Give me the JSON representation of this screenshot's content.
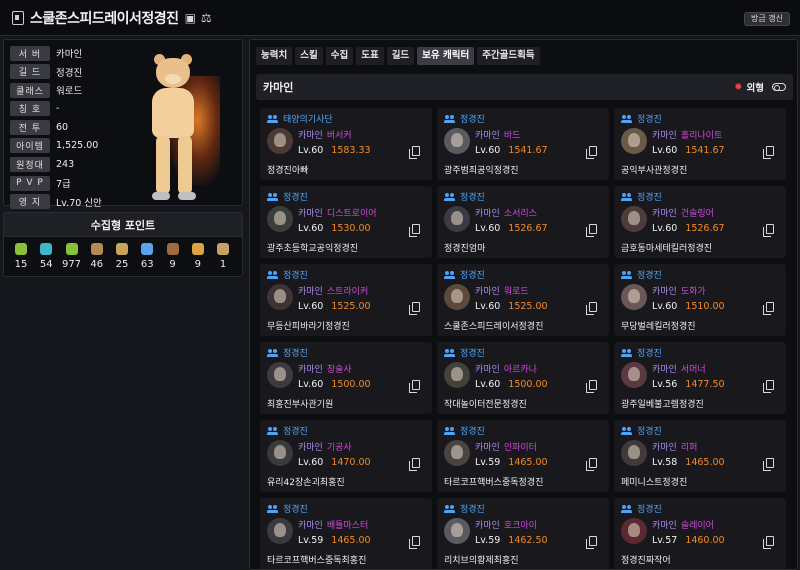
{
  "header": {
    "title": "스쿨존스피드레이서정경진",
    "refresh_label": "방금 갱신"
  },
  "profile": {
    "rows": [
      {
        "label": "서 버",
        "value": "카마인"
      },
      {
        "label": "길 드",
        "value": "정경진"
      },
      {
        "label": "클래스",
        "value": "워로드"
      },
      {
        "label": "칭 호",
        "value": "-"
      },
      {
        "label": "전 투",
        "value": "60"
      },
      {
        "label": "아이템",
        "value": "1,525.00"
      },
      {
        "label": "원정대",
        "value": "243"
      },
      {
        "label": "P V P",
        "value": "7급"
      },
      {
        "label": "영 지",
        "value": "Lv.70 신안"
      }
    ]
  },
  "points": {
    "title": "수집형 포인트",
    "items": [
      {
        "icon": "mokoko-seed-icon",
        "color": "#8bbf3a",
        "value": "15"
      },
      {
        "icon": "island-heart-icon",
        "color": "#3fb7c9",
        "value": "54"
      },
      {
        "icon": "sprout-icon",
        "color": "#86c13c",
        "value": "977"
      },
      {
        "icon": "art-scroll-icon",
        "color": "#b48a52",
        "value": "46"
      },
      {
        "icon": "telescope-icon",
        "color": "#c8a35a",
        "value": "25"
      },
      {
        "icon": "world-tree-leaf-icon",
        "color": "#5aa3e6",
        "value": "63"
      },
      {
        "icon": "ignea-token-icon",
        "color": "#a06a3c",
        "value": "9"
      },
      {
        "icon": "orpheus-star-icon",
        "color": "#d9a441",
        "value": "9"
      },
      {
        "icon": "sea-bounty-icon",
        "color": "#c7a064",
        "value": "1"
      }
    ]
  },
  "tabs": [
    "능력치",
    "스킬",
    "수집",
    "도표",
    "길드",
    "보유 캐릭터",
    "주간골드획득"
  ],
  "server_section": {
    "name": "카마인",
    "appearance_label": "외형"
  },
  "characters": [
    {
      "guild": "태양의기사단",
      "server": "카마인",
      "class": "버서커",
      "level": "Lv.60",
      "item_level": "1583.33",
      "name": "정경진아빠"
    },
    {
      "guild": "정경진",
      "server": "카마인",
      "class": "바드",
      "level": "Lv.60",
      "item_level": "1541.67",
      "name": "광주범죄공익정경진"
    },
    {
      "guild": "정경진",
      "server": "카마인",
      "class": "홀리나이트",
      "level": "Lv.60",
      "item_level": "1541.67",
      "name": "공익부사관정경진"
    },
    {
      "guild": "정경진",
      "server": "카마인",
      "class": "디스트로이어",
      "level": "Lv.60",
      "item_level": "1530.00",
      "name": "광주초등학교공익정경진"
    },
    {
      "guild": "정경진",
      "server": "카마인",
      "class": "소서리스",
      "level": "Lv.60",
      "item_level": "1526.67",
      "name": "정경진엄마"
    },
    {
      "guild": "정경진",
      "server": "카마인",
      "class": "건슬링어",
      "level": "Lv.60",
      "item_level": "1526.67",
      "name": "금호동마세테킬러정경진"
    },
    {
      "guild": "정경진",
      "server": "카마인",
      "class": "스트라이커",
      "level": "Lv.60",
      "item_level": "1525.00",
      "name": "무등산피바라기정경진"
    },
    {
      "guild": "정경진",
      "server": "카마인",
      "class": "워로드",
      "level": "Lv.60",
      "item_level": "1525.00",
      "name": "스쿨존스피드레이서정경진"
    },
    {
      "guild": "정경진",
      "server": "카마인",
      "class": "도화가",
      "level": "Lv.60",
      "item_level": "1510.00",
      "name": "무당벌레킬러정경진"
    },
    {
      "guild": "정경진",
      "server": "카마인",
      "class": "창술사",
      "level": "Lv.60",
      "item_level": "1500.00",
      "name": "최홍진부사관기원"
    },
    {
      "guild": "정경진",
      "server": "카마인",
      "class": "아르카나",
      "level": "Lv.60",
      "item_level": "1500.00",
      "name": "작대놀이터전문정경진"
    },
    {
      "guild": "정경진",
      "server": "카마인",
      "class": "서머너",
      "level": "Lv.56",
      "item_level": "1477.50",
      "name": "광주일베불고렘정경진"
    },
    {
      "guild": "정경진",
      "server": "카마인",
      "class": "기공사",
      "level": "Lv.60",
      "item_level": "1470.00",
      "name": "유리42장손괴최홍진"
    },
    {
      "guild": "정경진",
      "server": "카마인",
      "class": "인파이터",
      "level": "Lv.59",
      "item_level": "1465.00",
      "name": "타르코프핵버스중독정경진"
    },
    {
      "guild": "정경진",
      "server": "카마인",
      "class": "리퍼",
      "level": "Lv.58",
      "item_level": "1465.00",
      "name": "페미니스트정경진"
    },
    {
      "guild": "정경진",
      "server": "카마인",
      "class": "배틀마스터",
      "level": "Lv.59",
      "item_level": "1465.00",
      "name": "타르코프핵버스중독최홍진"
    },
    {
      "guild": "정경진",
      "server": "카마인",
      "class": "호크아이",
      "level": "Lv.59",
      "item_level": "1462.50",
      "name": "리치브의황제최홍진"
    },
    {
      "guild": "정경진",
      "server": "카마인",
      "class": "슬레이어",
      "level": "Lv.57",
      "item_level": "1460.00",
      "name": "정경진짜작어"
    }
  ]
}
